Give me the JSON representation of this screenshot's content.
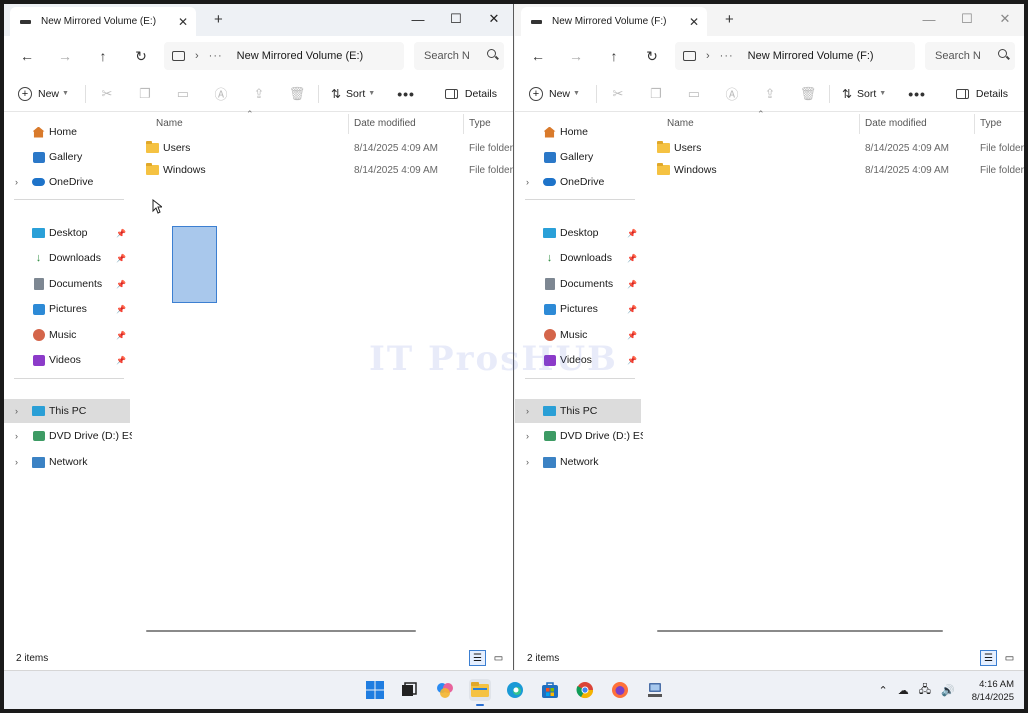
{
  "watermark": "IT ProsHUB",
  "windows": {
    "left": {
      "tab_title": "New Mirrored Volume (E:)",
      "address": "New Mirrored Volume (E:)",
      "search_placeholder": "Search N",
      "status_count": "2 items"
    },
    "right": {
      "tab_title": "New Mirrored Volume (F:)",
      "address": "New Mirrored Volume (F:)",
      "search_placeholder": "Search N",
      "status_count": "2 items"
    }
  },
  "toolbar": {
    "new_label": "New",
    "sort_label": "Sort",
    "more_label": "•••",
    "details_label": "Details"
  },
  "columns": {
    "name": "Name",
    "date": "Date modified",
    "type": "Type"
  },
  "files": [
    {
      "name": "Users",
      "date": "8/14/2025 4:09 AM",
      "type": "File folder"
    },
    {
      "name": "Windows",
      "date": "8/14/2025 4:09 AM",
      "type": "File folder"
    }
  ],
  "nav": {
    "home": "Home",
    "gallery": "Gallery",
    "onedrive": "OneDrive",
    "desktop": "Desktop",
    "downloads": "Downloads",
    "documents": "Documents",
    "pictures": "Pictures",
    "music": "Music",
    "videos": "Videos",
    "this_pc": "This PC",
    "dvd": "DVD Drive (D:) ESD-",
    "network": "Network"
  },
  "taskbar": {
    "time": "4:16 AM",
    "date": "8/14/2025"
  }
}
